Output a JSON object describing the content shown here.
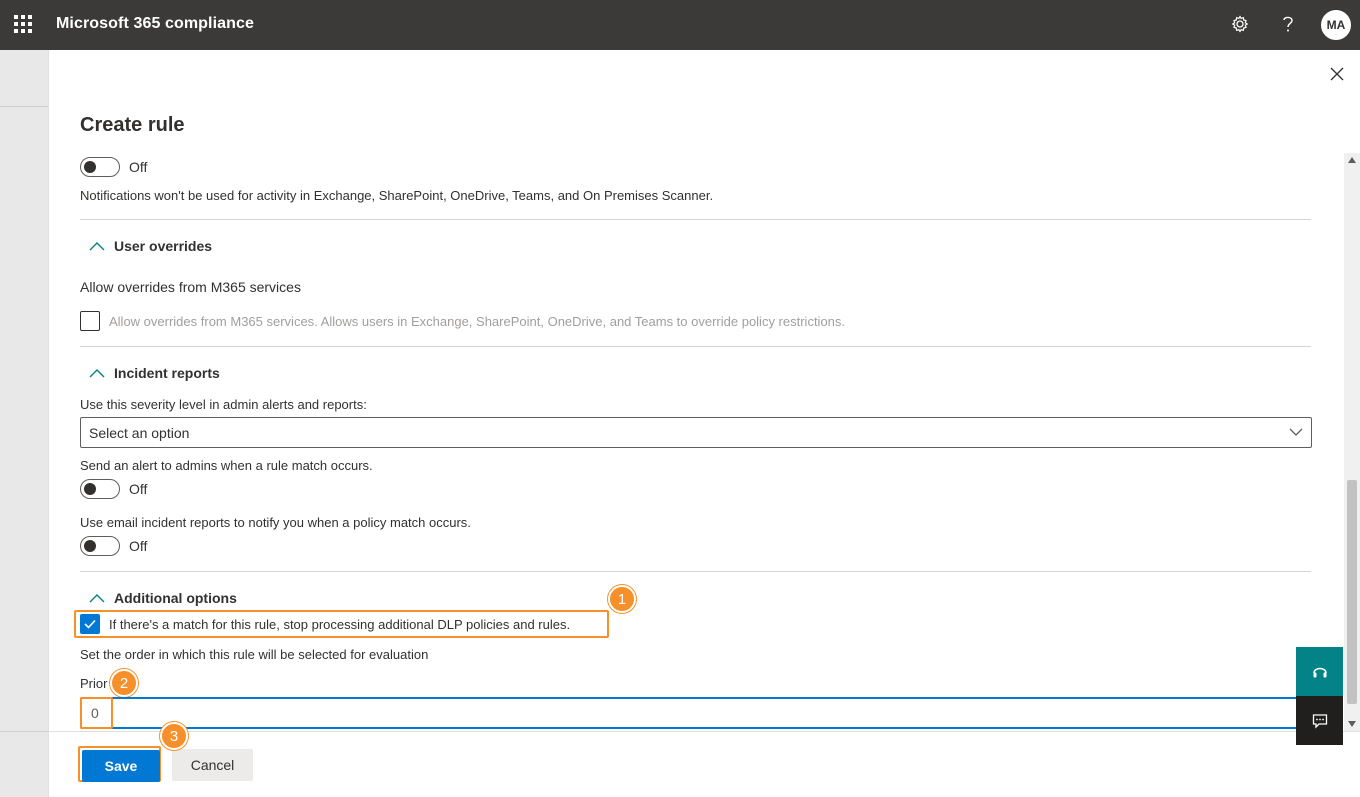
{
  "header": {
    "app_title": "Microsoft 365 compliance",
    "settings_icon": "gear-icon",
    "help_icon": "question-icon",
    "avatar_initials": "MA",
    "background_color": "#3b3a39"
  },
  "panel": {
    "title": "Create rule",
    "close_icon": "close-icon"
  },
  "notifications": {
    "toggle_state": "Off",
    "description": "Notifications won't be used for activity in Exchange, SharePoint, OneDrive, Teams, and On Premises Scanner."
  },
  "user_overrides": {
    "heading": "User overrides",
    "label": "Allow overrides from M365 services",
    "checkbox_text": "Allow overrides from M365 services. Allows users in Exchange, SharePoint, OneDrive, and Teams to override policy restrictions.",
    "checked": false
  },
  "incident_reports": {
    "heading": "Incident reports",
    "severity_label": "Use this severity level in admin alerts and reports:",
    "severity_placeholder": "Select an option",
    "alert_label": "Send an alert to admins when a rule match occurs.",
    "alert_toggle": "Off",
    "email_label": "Use email incident reports to notify you when a policy match occurs.",
    "email_toggle": "Off"
  },
  "additional_options": {
    "heading": "Additional options",
    "stop_processing_text": "If there's a match for this rule, stop processing additional DLP policies and rules.",
    "stop_processing_checked": true,
    "order_label": "Set the order in which this rule will be selected for evaluation",
    "priority_label": "Prior",
    "priority_value": "0"
  },
  "callouts": {
    "one": "1",
    "two": "2",
    "three": "3",
    "color": "#f7902a"
  },
  "footer": {
    "save_label": "Save",
    "cancel_label": "Cancel"
  },
  "accent_color": "#0078d4"
}
